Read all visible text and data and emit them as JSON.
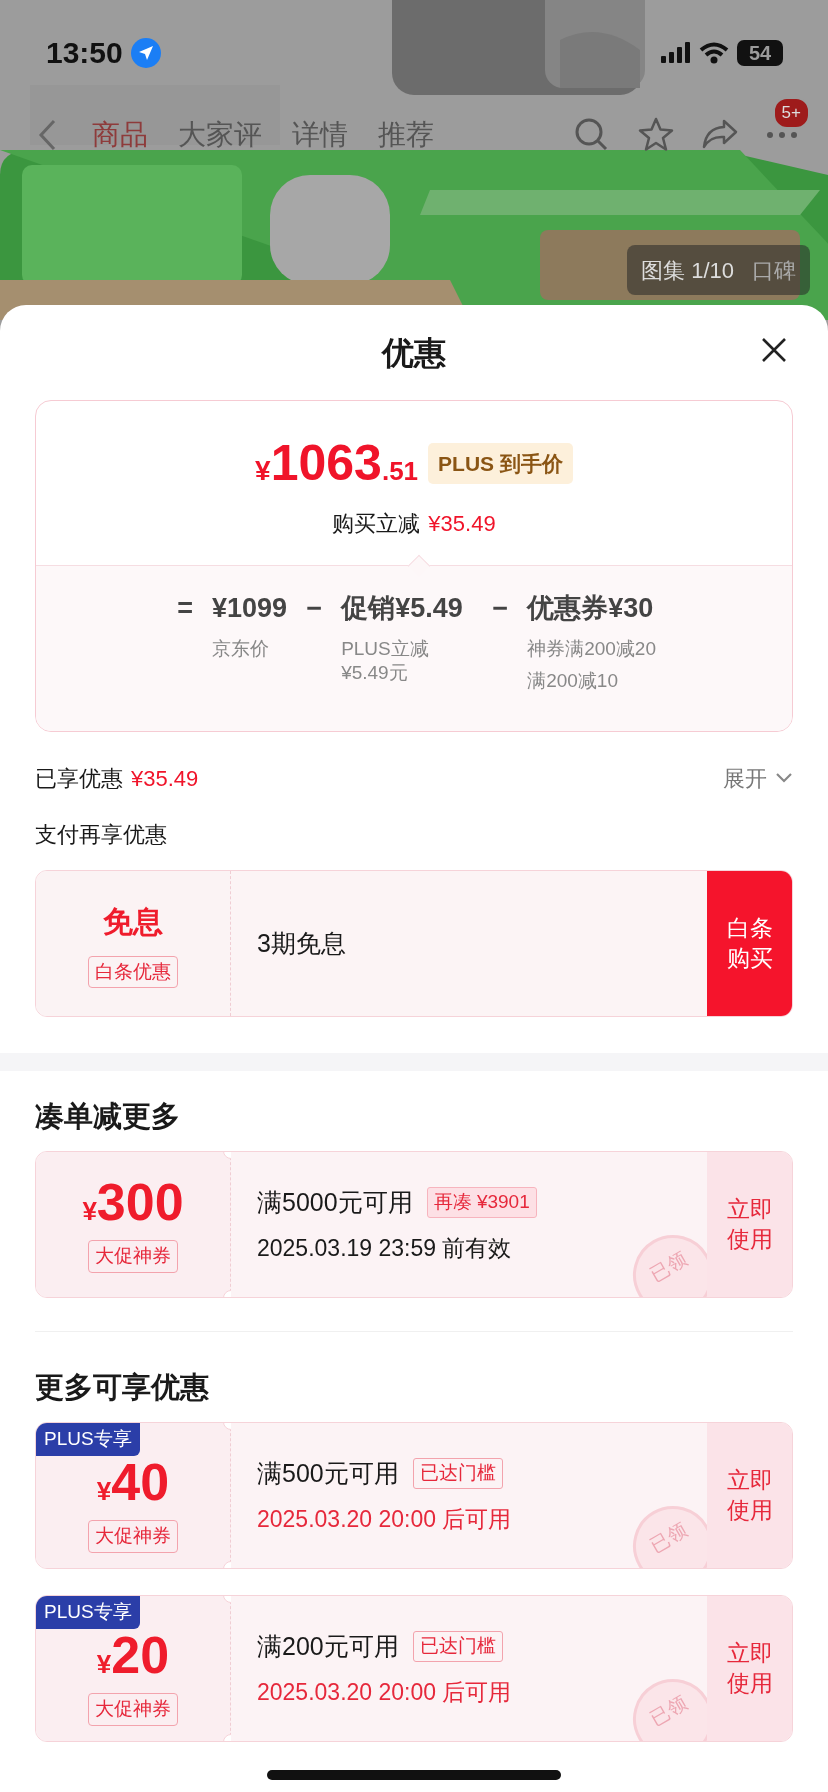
{
  "status_bar": {
    "time": "13:50",
    "battery": "54"
  },
  "product_nav": {
    "tabs": [
      {
        "label": "商品",
        "selected": true
      },
      {
        "label": "大家评",
        "selected": false
      },
      {
        "label": "详情",
        "selected": false
      },
      {
        "label": "推荐",
        "selected": false
      }
    ],
    "more_badge": "5+"
  },
  "gallery": {
    "kind": "picture",
    "tabs": [
      {
        "label": "图集 1/10",
        "selected": true
      },
      {
        "label": "口碑",
        "selected": false
      }
    ]
  },
  "sheet": {
    "title": "优惠"
  },
  "price_card": {
    "currency": "¥",
    "price_int": "1063",
    "price_dec": ".51",
    "price_tag": "PLUS 到手价",
    "saving_label": "购买立减",
    "saving": "¥35.49",
    "breakdown": [
      {
        "op": "=",
        "amount": "¥1099",
        "notes": [
          "京东价"
        ]
      },
      {
        "op": "−",
        "amount": "促销¥5.49",
        "notes": [
          "PLUS立减¥5.49元"
        ]
      },
      {
        "op": "−",
        "amount": "优惠券¥30",
        "notes": [
          "神券满200减20",
          "满200减10"
        ]
      }
    ]
  },
  "enjoyed": {
    "label": "已享优惠",
    "amount": "¥35.49",
    "toggle": "展开"
  },
  "payment": {
    "title": "支付再享优惠",
    "offer": {
      "name": "免息",
      "tag": "白条优惠",
      "desc": "3期免息",
      "action": "白条购买"
    }
  },
  "sections": [
    {
      "title": "凑单减更多",
      "coupons": [
        {
          "kind": "shortfall",
          "currency": "¥",
          "amount": "300",
          "type": "大促神券",
          "condition": "满5000元可用",
          "tag": "再凑 ¥3901",
          "validity": "2025.03.19 23:59 前有效",
          "stamp": "已领",
          "action": "立即使用"
        }
      ]
    },
    {
      "title": "更多可享优惠",
      "coupons": [
        {
          "kind": "reached",
          "badge": "PLUS专享",
          "currency": "¥",
          "amount": "40",
          "type": "大促神券",
          "condition": "满500元可用",
          "tag": "已达门槛",
          "validity": "2025.03.20 20:00 后可用",
          "stamp": "已领",
          "action": "立即使用"
        },
        {
          "kind": "reached",
          "badge": "PLUS专享",
          "currency": "¥",
          "amount": "20",
          "type": "大促神券",
          "condition": "满200元可用",
          "tag": "已达门槛",
          "validity": "2025.03.20 20:00 后可用",
          "stamp": "已领",
          "action": "立即使用"
        }
      ]
    }
  ]
}
